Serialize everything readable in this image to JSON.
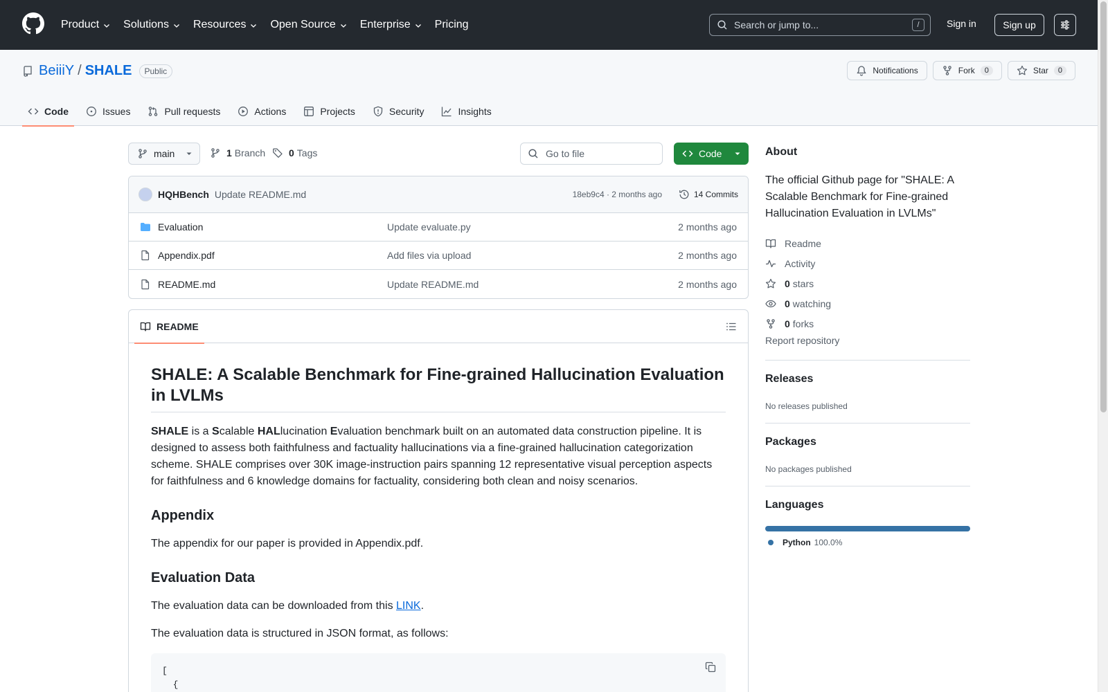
{
  "header": {
    "nav": [
      {
        "label": "Product",
        "has_caret": true
      },
      {
        "label": "Solutions",
        "has_caret": true
      },
      {
        "label": "Resources",
        "has_caret": true
      },
      {
        "label": "Open Source",
        "has_caret": true
      },
      {
        "label": "Enterprise",
        "has_caret": true
      },
      {
        "label": "Pricing",
        "has_caret": false
      }
    ],
    "search_placeholder": "Search or jump to...",
    "search_shortcut": "/",
    "sign_in": "Sign in",
    "sign_up": "Sign up"
  },
  "repo": {
    "owner": "BeiiiY",
    "separator": "/",
    "name": "SHALE",
    "visibility": "Public",
    "actions": {
      "notifications": "Notifications",
      "fork": "Fork",
      "fork_count": "0",
      "star": "Star",
      "star_count": "0"
    },
    "tabs": [
      {
        "label": "Code",
        "icon": "code-icon",
        "active": true
      },
      {
        "label": "Issues",
        "icon": "issue-icon",
        "active": false
      },
      {
        "label": "Pull requests",
        "icon": "pull-request-icon",
        "active": false
      },
      {
        "label": "Actions",
        "icon": "play-icon",
        "active": false
      },
      {
        "label": "Projects",
        "icon": "table-icon",
        "active": false
      },
      {
        "label": "Security",
        "icon": "shield-icon",
        "active": false
      },
      {
        "label": "Insights",
        "icon": "graph-icon",
        "active": false
      }
    ]
  },
  "toolbar": {
    "branch": "main",
    "branches_count": "1",
    "branches_label": "Branch",
    "tags_count": "0",
    "tags_label": "Tags",
    "go_to_file": "Go to file",
    "code_button": "Code"
  },
  "latest_commit": {
    "author": "HQHBench",
    "message": "Update README.md",
    "meta": "18eb9c4 · 2 months ago",
    "commits_label": "14 Commits"
  },
  "files": [
    {
      "name": "Evaluation",
      "type": "folder",
      "commit": "Update evaluate.py",
      "time": "2 months ago"
    },
    {
      "name": "Appendix.pdf",
      "type": "file",
      "commit": "Add files via upload",
      "time": "2 months ago"
    },
    {
      "name": "README.md",
      "type": "file",
      "commit": "Update README.md",
      "time": "2 months ago"
    }
  ],
  "readme": {
    "tab_label": "README",
    "title": "SHALE: A Scalable Benchmark for Fine-grained Hallucination Evaluation in LVLMs",
    "intro": {
      "b1": "SHALE",
      "t1": " is a ",
      "b2": "S",
      "t2": "calable ",
      "b3": "HAL",
      "t3": "lucination ",
      "b4": "E",
      "t4": "valuation benchmark built on an automated data construction pipeline. It is designed to assess both faithfulness and factuality hallucinations via a fine-grained hallucination categorization scheme. SHALE comprises over 30K image-instruction pairs spanning 12 representative visual perception aspects for faithfulness and 6 knowledge domains for factuality, considering both clean and noisy scenarios."
    },
    "appendix_heading": "Appendix",
    "appendix_text": "The appendix for our paper is provided in Appendix.pdf.",
    "eval_heading": "Evaluation Data",
    "eval_text_before": "The evaluation data can be downloaded from this ",
    "eval_link": "LINK",
    "eval_text_after": ".",
    "eval_format_text": "The evaluation data is structured in JSON format, as follows:",
    "code_line1": "[",
    "code_line2": "  {"
  },
  "sidebar": {
    "about_heading": "About",
    "description": "The official Github page for \"SHALE: A Scalable Benchmark for Fine-grained Hallucination Evaluation in LVLMs\"",
    "readme_link": "Readme",
    "activity_link": "Activity",
    "stars_count": "0",
    "stars_label": "stars",
    "watching_count": "0",
    "watching_label": "watching",
    "forks_count": "0",
    "forks_label": "forks",
    "report": "Report repository",
    "releases_heading": "Releases",
    "releases_text": "No releases published",
    "packages_heading": "Packages",
    "packages_text": "No packages published",
    "languages_heading": "Languages",
    "language_name": "Python",
    "language_pct": "100.0%",
    "language_color": "#3572a5"
  }
}
